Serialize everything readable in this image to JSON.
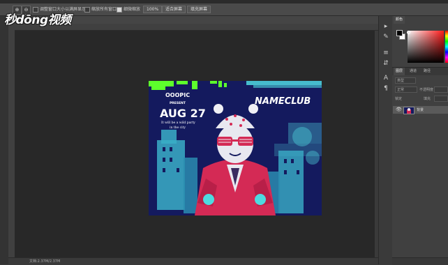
{
  "branding": {
    "logo_text": "秒dōng视频"
  },
  "options_bar": {
    "resize_windows_label": "调整窗口大小以满屏显示",
    "zoom_all_windows_label": "缩放所有窗口",
    "scrubby_zoom_label": "细微缩放",
    "zoom_value": "100%",
    "fit_screen_label": "适合屏幕",
    "fill_screen_label": "填充屏幕"
  },
  "icons": [
    "zoom-in-icon",
    "zoom-out-icon",
    "eye-icon",
    "foreground-color-swatch"
  ],
  "colors": {
    "foreground": "#000000",
    "background": "#ffffff",
    "picker_hue": "#ff1a1a"
  },
  "right_panel": {
    "color_tab": "颜色",
    "layers_tabs": [
      "图层",
      "通道",
      "路径"
    ],
    "filter_label": "类型",
    "blend_mode": "正常",
    "opacity_label": "不透明度",
    "lock_label": "锁定",
    "fill_label": "填充",
    "layer_name": "背景"
  },
  "document": {
    "text_brand": "OOOPIC",
    "text_present": "PRESENT",
    "text_date": "AUG 27",
    "text_party_line1": "It will be a wild party",
    "text_party_line2": "in the city",
    "text_club": "NAMECLUB"
  },
  "status_bar": {
    "text": "文档:2.37M/2.37M"
  }
}
